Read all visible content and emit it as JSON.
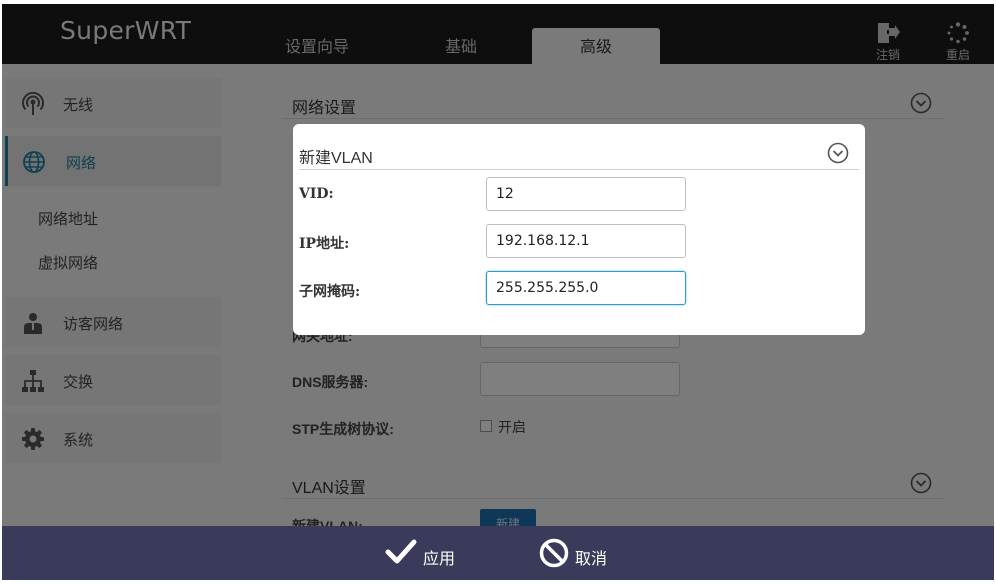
{
  "header": {
    "brand": "SuperWRT",
    "tabs": [
      "设置向导",
      "基础",
      "高级"
    ],
    "logout_label": "注销",
    "reboot_label": "重启"
  },
  "sidebar": {
    "items": [
      {
        "label": "无线",
        "icon": "wireless-icon"
      },
      {
        "label": "网络",
        "icon": "globe-icon"
      },
      {
        "label": "访客网络",
        "icon": "guest-user-icon"
      },
      {
        "label": "交换",
        "icon": "switch-topology-icon"
      },
      {
        "label": "系统",
        "icon": "gear-icon"
      }
    ],
    "sub_items": [
      "网络地址",
      "虚拟网络"
    ]
  },
  "main": {
    "network_section_title": "网络设置",
    "gateway_label": "网关地址:",
    "dns_label": "DNS服务器:",
    "stp_label": "STP生成树协议:",
    "stp_option": "开启",
    "vlan_section_title": "VLAN设置",
    "new_vlan_label": "新建VLAN:",
    "new_vlan_button": "新建"
  },
  "modal": {
    "title": "新建VLAN",
    "fields": [
      {
        "label": "VID:",
        "value": "12"
      },
      {
        "label": "IP地址:",
        "value": "192.168.12.1"
      },
      {
        "label": "子网掩码:",
        "value": "255.255.255.0"
      }
    ]
  },
  "footer": {
    "apply_label": "应用",
    "cancel_label": "取消"
  },
  "colors": {
    "header_bg": "#1d1d1f",
    "footer_bg": "#3a3a5a",
    "accent": "#1e7fa0",
    "focus_border": "#2a9ad6"
  }
}
